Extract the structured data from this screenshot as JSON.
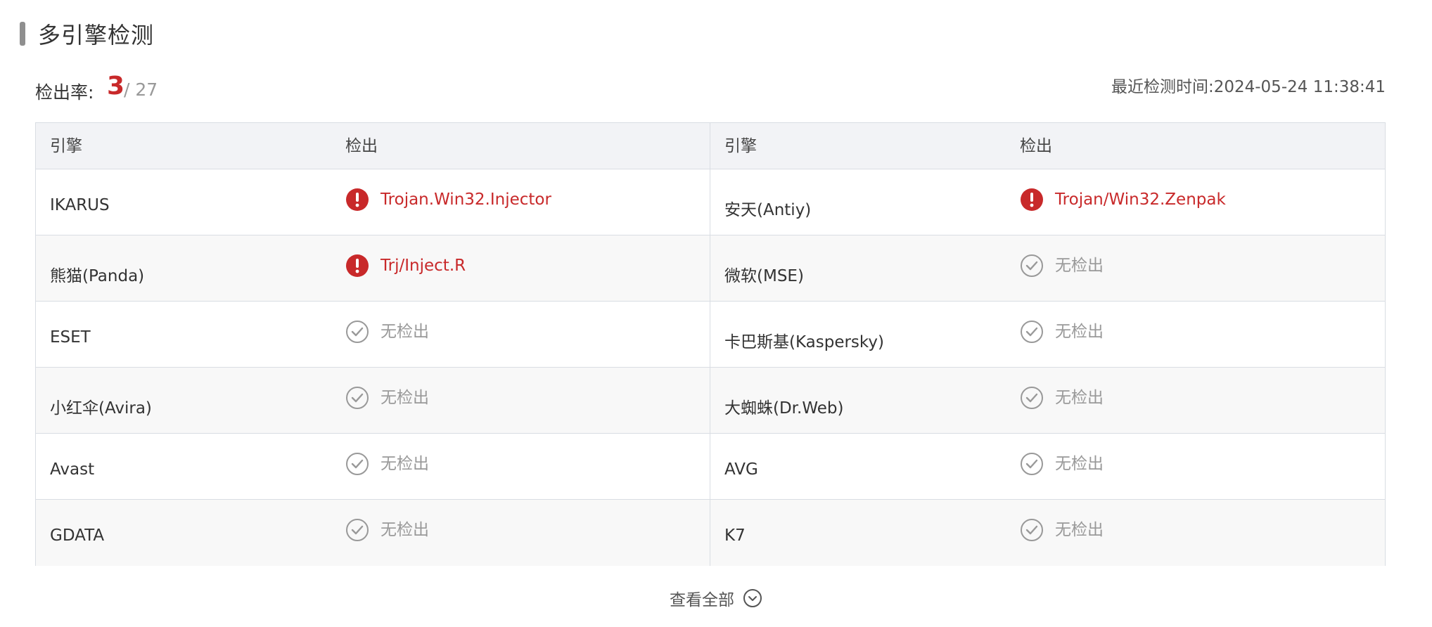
{
  "section": {
    "title": "多引擎检测"
  },
  "rate": {
    "label": "检出率:",
    "hit": "3",
    "total": "/ 27"
  },
  "last_check": "最近检测时间:2024-05-24 11:38:41",
  "table": {
    "headers": {
      "engine": "引擎",
      "result": "检出"
    },
    "rows": [
      {
        "left": {
          "engine": "IKARUS",
          "result": "Trojan.Win32.Injector",
          "status": "hit"
        },
        "right": {
          "engine": "安天(Antiy)",
          "result": "Trojan/Win32.Zenpak",
          "status": "hit"
        }
      },
      {
        "left": {
          "engine": "熊猫(Panda)",
          "result": "Trj/Inject.R",
          "status": "hit"
        },
        "right": {
          "engine": "微软(MSE)",
          "result": "无检出",
          "status": "clean"
        }
      },
      {
        "left": {
          "engine": "ESET",
          "result": "无检出",
          "status": "clean"
        },
        "right": {
          "engine": "卡巴斯基(Kaspersky)",
          "result": "无检出",
          "status": "clean"
        }
      },
      {
        "left": {
          "engine": "小红伞(Avira)",
          "result": "无检出",
          "status": "clean"
        },
        "right": {
          "engine": "大蜘蛛(Dr.Web)",
          "result": "无检出",
          "status": "clean"
        }
      },
      {
        "left": {
          "engine": "Avast",
          "result": "无检出",
          "status": "clean"
        },
        "right": {
          "engine": "AVG",
          "result": "无检出",
          "status": "clean"
        }
      },
      {
        "left": {
          "engine": "GDATA",
          "result": "无检出",
          "status": "clean"
        },
        "right": {
          "engine": "K7",
          "result": "无检出",
          "status": "clean"
        }
      }
    ]
  },
  "view_all": {
    "label": "查看全部",
    "icon": "chevron-down-circle-icon"
  },
  "colors": {
    "hit": "#c8292a",
    "clean": "#999999",
    "header_bg": "#f2f3f6",
    "border": "#d9dde3"
  },
  "icons": {
    "hit": "alert-circle-icon",
    "clean": "check-circle-icon"
  }
}
